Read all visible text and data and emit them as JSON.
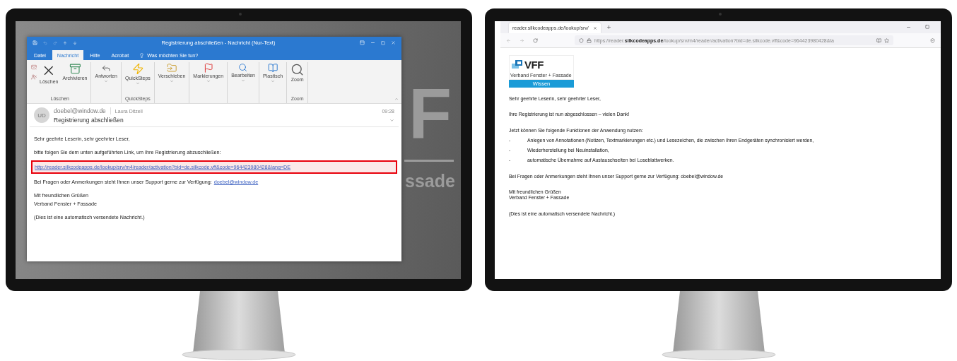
{
  "outlook_monitor": {
    "wallpaper_texts": [
      "F",
      "ssade"
    ],
    "window": {
      "title": "Registrierung abschließen  -  Nachricht (Nur-Text)",
      "tabs": [
        {
          "label": "Datei",
          "selected": false
        },
        {
          "label": "Nachricht",
          "selected": true
        },
        {
          "label": "Hilfe",
          "selected": false
        },
        {
          "label": "Acrobat",
          "selected": false
        }
      ],
      "tell_me": "Was möchten Sie tun?",
      "ribbon_groups": [
        {
          "label": "Löschen",
          "buttons": [
            {
              "kind": "delete",
              "label": "Löschen",
              "dropdown": false
            },
            {
              "kind": "archive",
              "label": "Archivieren",
              "dropdown": false
            }
          ]
        },
        {
          "buttons": [
            {
              "kind": "reply",
              "label": "Antworten",
              "dropdown": true
            }
          ]
        },
        {
          "label": "QuickSteps",
          "buttons": [
            {
              "kind": "quicksteps",
              "label": "QuickSteps",
              "dropdown": true
            }
          ]
        },
        {
          "buttons": [
            {
              "kind": "move",
              "label": "Verschieben",
              "dropdown": true
            }
          ]
        },
        {
          "buttons": [
            {
              "kind": "flag",
              "label": "Markierungen",
              "dropdown": true
            }
          ]
        },
        {
          "buttons": [
            {
              "kind": "edit",
              "label": "Bearbeiten",
              "dropdown": true
            }
          ]
        },
        {
          "buttons": [
            {
              "kind": "immersive",
              "label": "Plastisch",
              "dropdown": true
            }
          ]
        },
        {
          "label": "Zoom",
          "buttons": [
            {
              "kind": "zoom",
              "label": "Zoom",
              "dropdown": false
            }
          ]
        }
      ],
      "message": {
        "avatar": "UD",
        "from": "doebel@window.de",
        "to": "Laura Ditzell",
        "time": "09:28",
        "subject": "Registrierung abschließen"
      },
      "paragraphs": [
        {
          "kind": "text",
          "lines": [
            "Sehr geehrte Leserin, sehr geehrter Leser,"
          ]
        },
        {
          "kind": "text",
          "lines": [
            "bitte folgen Sie dem unten aufgeführten Link, um Ihre Registrierung abzuschließen:"
          ]
        },
        {
          "kind": "link",
          "text": "http://reader.silkcodeapps.de/lookup/srv/m4/reader/activation?bid=de.silkcode.vff&code=964423980428&lang=DE",
          "highlighted": true
        },
        {
          "kind": "contact",
          "text": "Bei Fragen oder Anmerkungen steht Ihnen unser Support gerne zur Verfügung:",
          "link": "doebel@window.de"
        },
        {
          "kind": "text",
          "lines": [
            "Mit freundlichen Grüßen",
            "Verband Fenster + Fassade"
          ]
        },
        {
          "kind": "text",
          "lines": [
            "(Dies ist eine automatisch versendete Nachricht.)"
          ]
        }
      ]
    }
  },
  "browser_monitor": {
    "tab": {
      "title": "reader.silkcodeapps.de/lookup/srv/"
    },
    "url": "https://reader.**silkcodeapps.de**/lookup/srv/m4/reader/activation?bid=de.silkcode.vff&code=964423980428&la",
    "logo": {
      "mark": "VFF",
      "subtitle": "Verband Fenster + Fassade",
      "tag": "Wissen"
    },
    "paragraphs": [
      {
        "kind": "text",
        "lines": [
          "Sehr geehrte Leserin, sehr geehrter Leser,"
        ]
      },
      {
        "kind": "text",
        "lines": [
          "Ihre Registrierung ist nun abgeschlossen – vielen Dank!"
        ]
      },
      {
        "kind": "text",
        "lines": [
          "Jetzt können Sie folgende Funktionen der Anwendung nutzen:"
        ]
      },
      {
        "kind": "list",
        "items": [
          {
            "marker": "-",
            "text": "Anlegen von Annotationen (Notizen, Textmarkierungen etc.) und Lesezeichen, die zwischen Ihren Endgeräten synchronisiert werden,"
          },
          {
            "marker": "-",
            "text": "Wiederherstellung bei Neuinstallation,"
          },
          {
            "marker": "-",
            "text": "automatische Übernahme auf Austauschseiten bei Loseblattwerken."
          }
        ]
      },
      {
        "kind": "text",
        "lines": [
          "Bei Fragen oder Anmerkungen steht Ihnen unser Support gerne zur Verfügung: doebel@window.de"
        ]
      },
      {
        "kind": "text",
        "lines": [
          "Mit freundlichen Grüßen",
          "Verband Fenster + Fassade"
        ]
      },
      {
        "kind": "text",
        "lines": [
          "(Dies ist eine automatisch versendete Nachricht.)"
        ]
      }
    ]
  }
}
